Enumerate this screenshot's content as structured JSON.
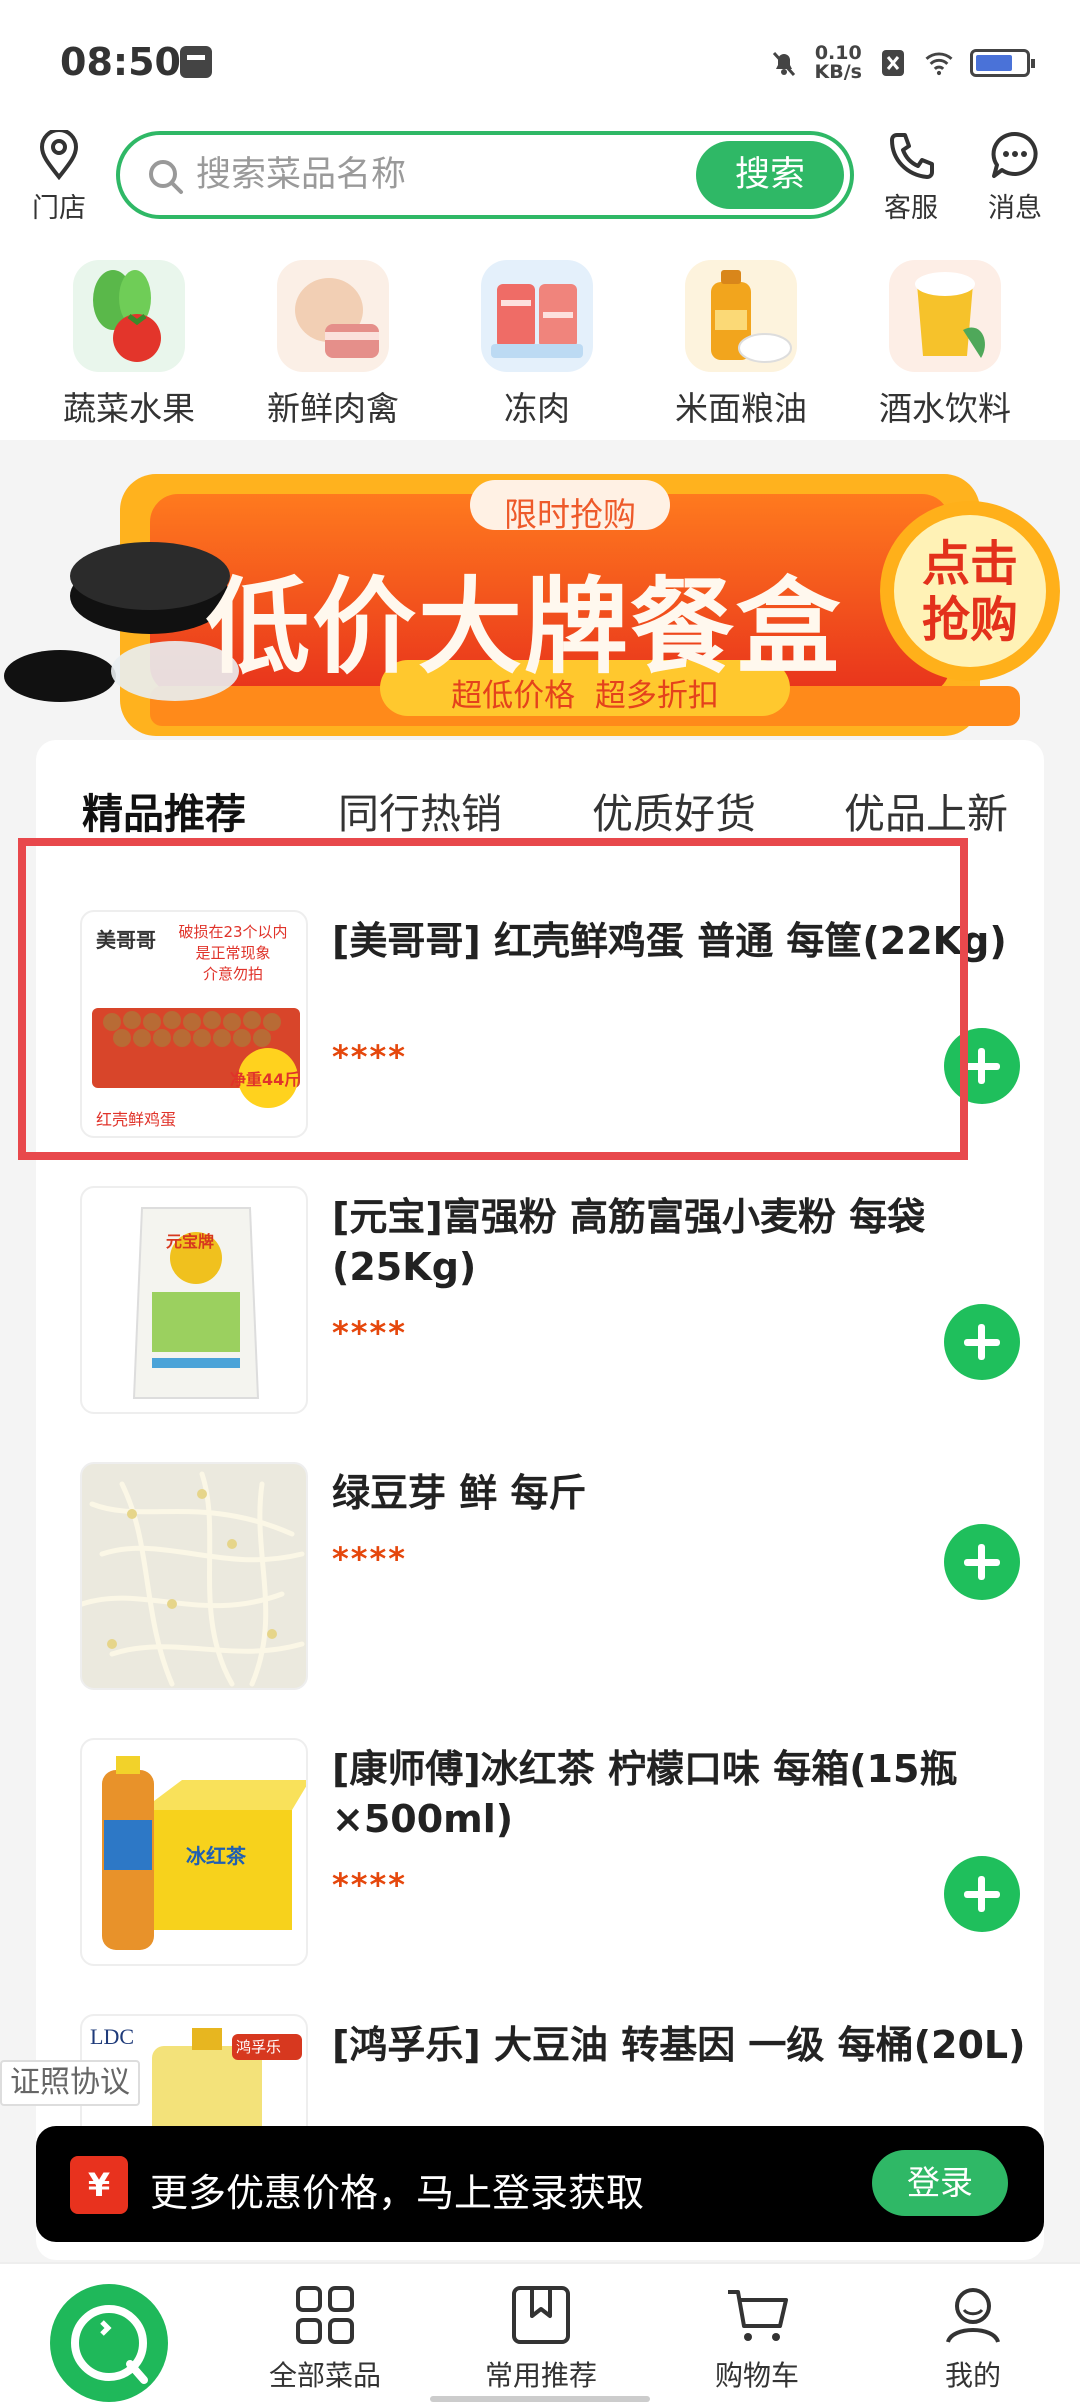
{
  "status_bar": {
    "time": "08:50",
    "net_speed_value": "0.10",
    "net_speed_unit": "KB/s"
  },
  "header": {
    "store_label": "门店",
    "search_placeholder": "搜索菜品名称",
    "search_button": "搜索",
    "service_label": "客服",
    "message_label": "消息"
  },
  "categories": [
    {
      "label": "蔬菜水果",
      "icon": "vegetables-icon"
    },
    {
      "label": "新鲜肉禽",
      "icon": "meat-icon"
    },
    {
      "label": "冻肉",
      "icon": "frozen-meat-icon"
    },
    {
      "label": "米面粮油",
      "icon": "grain-oil-icon"
    },
    {
      "label": "酒水饮料",
      "icon": "drinks-icon"
    }
  ],
  "banner": {
    "tag": "限时抢购",
    "title": "低价大牌餐盒",
    "subtitle": "超低价格  超多折扣",
    "cta_line1": "点击",
    "cta_line2": "抢购"
  },
  "tabs": [
    {
      "label": "精品推荐",
      "active": true
    },
    {
      "label": "同行热销",
      "active": false
    },
    {
      "label": "优质好货",
      "active": false
    },
    {
      "label": "优品上新",
      "active": false
    }
  ],
  "products": [
    {
      "name": "[美哥哥] 红壳鲜鸡蛋 普通 每筐(22Kg)",
      "price": "****",
      "thumb": {
        "brand": "美哥哥",
        "note1": "破损在23个以内",
        "note2": "是正常现象",
        "note3": "介意勿拍",
        "badge": "净重44斤",
        "caption": "红壳鲜鸡蛋"
      }
    },
    {
      "name": "[元宝]富强粉 高筋富强小麦粉 每袋(25Kg)",
      "price": "****",
      "thumb": {
        "brand": "元宝牌"
      }
    },
    {
      "name": "绿豆芽 鲜 每斤",
      "price": "****"
    },
    {
      "name": "[康师傅]冰红茶 柠檬口味 每箱(15瓶×500ml)",
      "price": "****",
      "thumb": {
        "brand": "冰红茶"
      }
    },
    {
      "name": "[鸿孚乐] 大豆油 转基因 一级 每桶(20L)",
      "price": "****",
      "thumb": {
        "brand1": "LDC",
        "brand2": "鸿孚乐"
      }
    }
  ],
  "license_label": "证照协议",
  "login_prompt": {
    "icon_text": "¥",
    "text": "更多优惠价格，马上登录获取",
    "button": "登录"
  },
  "bottom_nav": [
    {
      "label": "全部菜品",
      "icon": "grid-icon"
    },
    {
      "label": "常用推荐",
      "icon": "bookmark-icon"
    },
    {
      "label": "购物车",
      "icon": "cart-icon"
    },
    {
      "label": "我的",
      "icon": "user-icon"
    }
  ],
  "colors": {
    "brand_green": "#2fb866",
    "price_orange": "#e5470c",
    "highlight_red": "#e8484c"
  }
}
